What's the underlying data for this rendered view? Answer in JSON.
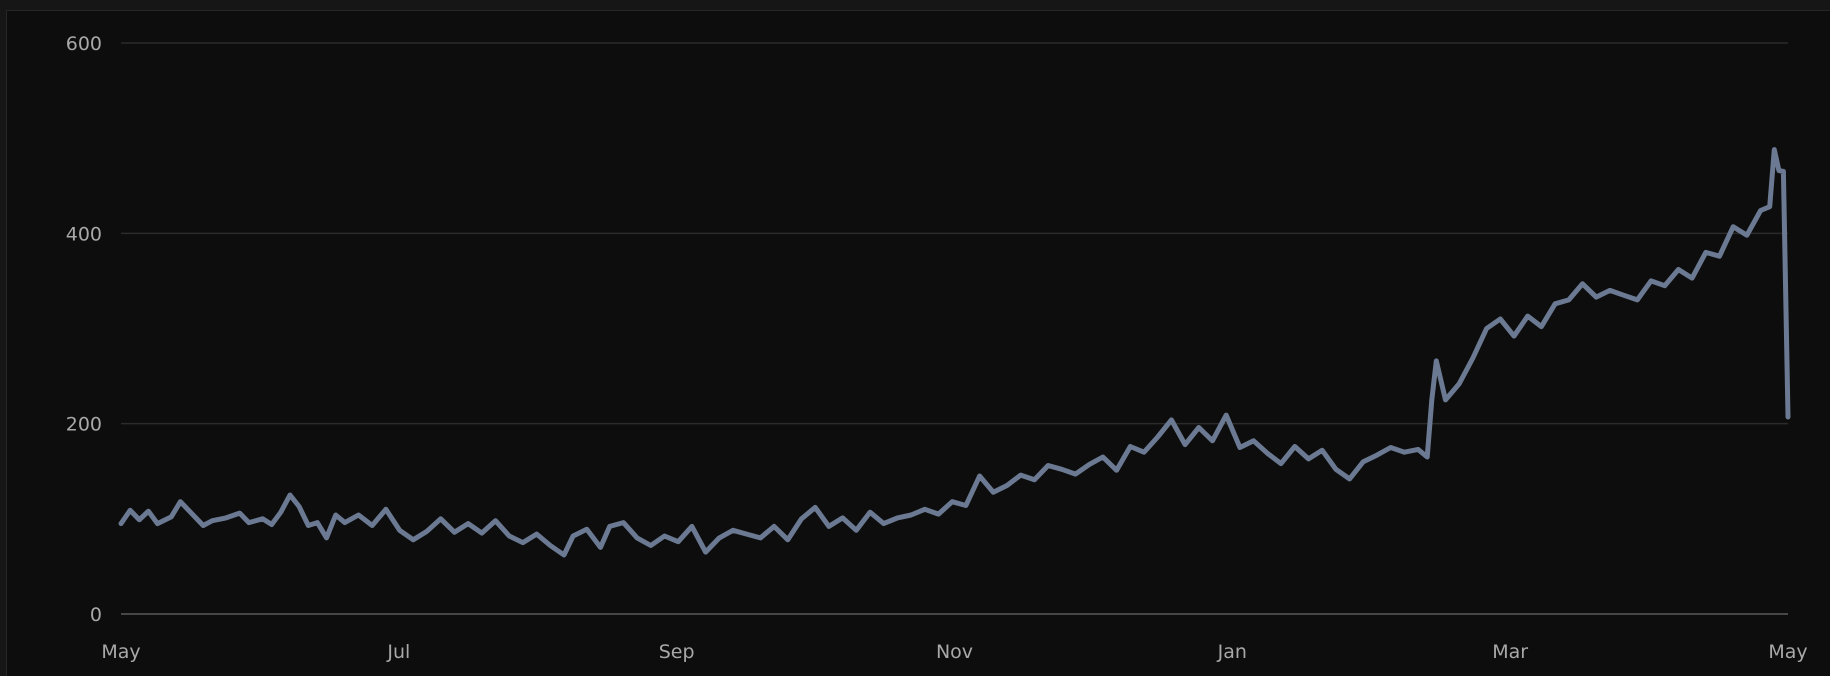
{
  "chart_data": {
    "type": "line",
    "title": "",
    "xlabel": "",
    "ylabel": "",
    "ylim": [
      0,
      600
    ],
    "yticks": [
      0,
      200,
      400,
      600
    ],
    "x_tick_labels": [
      "May",
      "Jul",
      "Sep",
      "Nov",
      "Jan",
      "Mar",
      "May"
    ],
    "grid": true,
    "legend": "none",
    "x_start": "2024-05-01",
    "x_end": "2025-05-01",
    "series": [
      {
        "color": "#6b7a92",
        "points": [
          [
            "2024-05-01",
            95
          ],
          [
            "2024-05-03",
            109
          ],
          [
            "2024-05-05",
            99
          ],
          [
            "2024-05-07",
            108
          ],
          [
            "2024-05-09",
            95
          ],
          [
            "2024-05-12",
            102
          ],
          [
            "2024-05-14",
            118
          ],
          [
            "2024-05-16",
            108
          ],
          [
            "2024-05-19",
            93
          ],
          [
            "2024-05-21",
            98
          ],
          [
            "2024-05-24",
            101
          ],
          [
            "2024-05-27",
            106
          ],
          [
            "2024-05-29",
            96
          ],
          [
            "2024-06-01",
            100
          ],
          [
            "2024-06-03",
            94
          ],
          [
            "2024-06-05",
            107
          ],
          [
            "2024-06-07",
            125
          ],
          [
            "2024-06-09",
            113
          ],
          [
            "2024-06-11",
            93
          ],
          [
            "2024-06-13",
            96
          ],
          [
            "2024-06-15",
            80
          ],
          [
            "2024-06-17",
            104
          ],
          [
            "2024-06-19",
            96
          ],
          [
            "2024-06-22",
            104
          ],
          [
            "2024-06-25",
            93
          ],
          [
            "2024-06-28",
            110
          ],
          [
            "2024-07-01",
            88
          ],
          [
            "2024-07-04",
            78
          ],
          [
            "2024-07-07",
            87
          ],
          [
            "2024-07-10",
            100
          ],
          [
            "2024-07-13",
            86
          ],
          [
            "2024-07-16",
            95
          ],
          [
            "2024-07-19",
            85
          ],
          [
            "2024-07-22",
            98
          ],
          [
            "2024-07-25",
            82
          ],
          [
            "2024-07-28",
            75
          ],
          [
            "2024-07-31",
            84
          ],
          [
            "2024-08-03",
            72
          ],
          [
            "2024-08-06",
            62
          ],
          [
            "2024-08-08",
            82
          ],
          [
            "2024-08-11",
            89
          ],
          [
            "2024-08-14",
            70
          ],
          [
            "2024-08-16",
            92
          ],
          [
            "2024-08-19",
            96
          ],
          [
            "2024-08-22",
            80
          ],
          [
            "2024-08-25",
            72
          ],
          [
            "2024-08-28",
            82
          ],
          [
            "2024-08-31",
            76
          ],
          [
            "2024-09-03",
            92
          ],
          [
            "2024-09-06",
            65
          ],
          [
            "2024-09-09",
            80
          ],
          [
            "2024-09-12",
            88
          ],
          [
            "2024-09-15",
            84
          ],
          [
            "2024-09-18",
            80
          ],
          [
            "2024-09-21",
            92
          ],
          [
            "2024-09-24",
            78
          ],
          [
            "2024-09-27",
            100
          ],
          [
            "2024-09-30",
            112
          ],
          [
            "2024-10-03",
            92
          ],
          [
            "2024-10-06",
            101
          ],
          [
            "2024-10-09",
            88
          ],
          [
            "2024-10-12",
            107
          ],
          [
            "2024-10-15",
            95
          ],
          [
            "2024-10-18",
            101
          ],
          [
            "2024-10-21",
            104
          ],
          [
            "2024-10-24",
            110
          ],
          [
            "2024-10-27",
            105
          ],
          [
            "2024-10-30",
            118
          ],
          [
            "2024-11-02",
            114
          ],
          [
            "2024-11-05",
            145
          ],
          [
            "2024-11-08",
            128
          ],
          [
            "2024-11-11",
            135
          ],
          [
            "2024-11-14",
            146
          ],
          [
            "2024-11-17",
            141
          ],
          [
            "2024-11-20",
            156
          ],
          [
            "2024-11-23",
            152
          ],
          [
            "2024-11-26",
            147
          ],
          [
            "2024-11-29",
            157
          ],
          [
            "2024-12-02",
            165
          ],
          [
            "2024-12-05",
            151
          ],
          [
            "2024-12-08",
            176
          ],
          [
            "2024-12-11",
            170
          ],
          [
            "2024-12-14",
            186
          ],
          [
            "2024-12-17",
            204
          ],
          [
            "2024-12-20",
            178
          ],
          [
            "2024-12-23",
            196
          ],
          [
            "2024-12-26",
            182
          ],
          [
            "2024-12-29",
            209
          ],
          [
            "2025-01-01",
            175
          ],
          [
            "2025-01-04",
            182
          ],
          [
            "2025-01-07",
            169
          ],
          [
            "2025-01-10",
            158
          ],
          [
            "2025-01-13",
            176
          ],
          [
            "2025-01-16",
            163
          ],
          [
            "2025-01-19",
            172
          ],
          [
            "2025-01-22",
            152
          ],
          [
            "2025-01-25",
            142
          ],
          [
            "2025-01-28",
            160
          ],
          [
            "2025-01-31",
            167
          ],
          [
            "2025-02-03",
            175
          ],
          [
            "2025-02-06",
            170
          ],
          [
            "2025-02-09",
            173
          ],
          [
            "2025-02-11",
            165
          ],
          [
            "2025-02-12",
            225
          ],
          [
            "2025-02-13",
            266
          ],
          [
            "2025-02-15",
            225
          ],
          [
            "2025-02-18",
            242
          ],
          [
            "2025-02-21",
            269
          ],
          [
            "2025-02-24",
            300
          ],
          [
            "2025-02-27",
            310
          ],
          [
            "2025-03-02",
            292
          ],
          [
            "2025-03-05",
            313
          ],
          [
            "2025-03-08",
            302
          ],
          [
            "2025-03-11",
            326
          ],
          [
            "2025-03-14",
            330
          ],
          [
            "2025-03-17",
            347
          ],
          [
            "2025-03-20",
            333
          ],
          [
            "2025-03-23",
            340
          ],
          [
            "2025-03-26",
            335
          ],
          [
            "2025-03-29",
            330
          ],
          [
            "2025-04-01",
            350
          ],
          [
            "2025-04-04",
            345
          ],
          [
            "2025-04-07",
            362
          ],
          [
            "2025-04-10",
            353
          ],
          [
            "2025-04-13",
            380
          ],
          [
            "2025-04-16",
            376
          ],
          [
            "2025-04-19",
            407
          ],
          [
            "2025-04-22",
            398
          ],
          [
            "2025-04-25",
            424
          ],
          [
            "2025-04-27",
            428
          ],
          [
            "2025-04-28",
            488
          ],
          [
            "2025-04-29",
            466
          ],
          [
            "2025-04-30",
            465
          ],
          [
            "2025-05-01",
            207
          ]
        ]
      }
    ]
  }
}
